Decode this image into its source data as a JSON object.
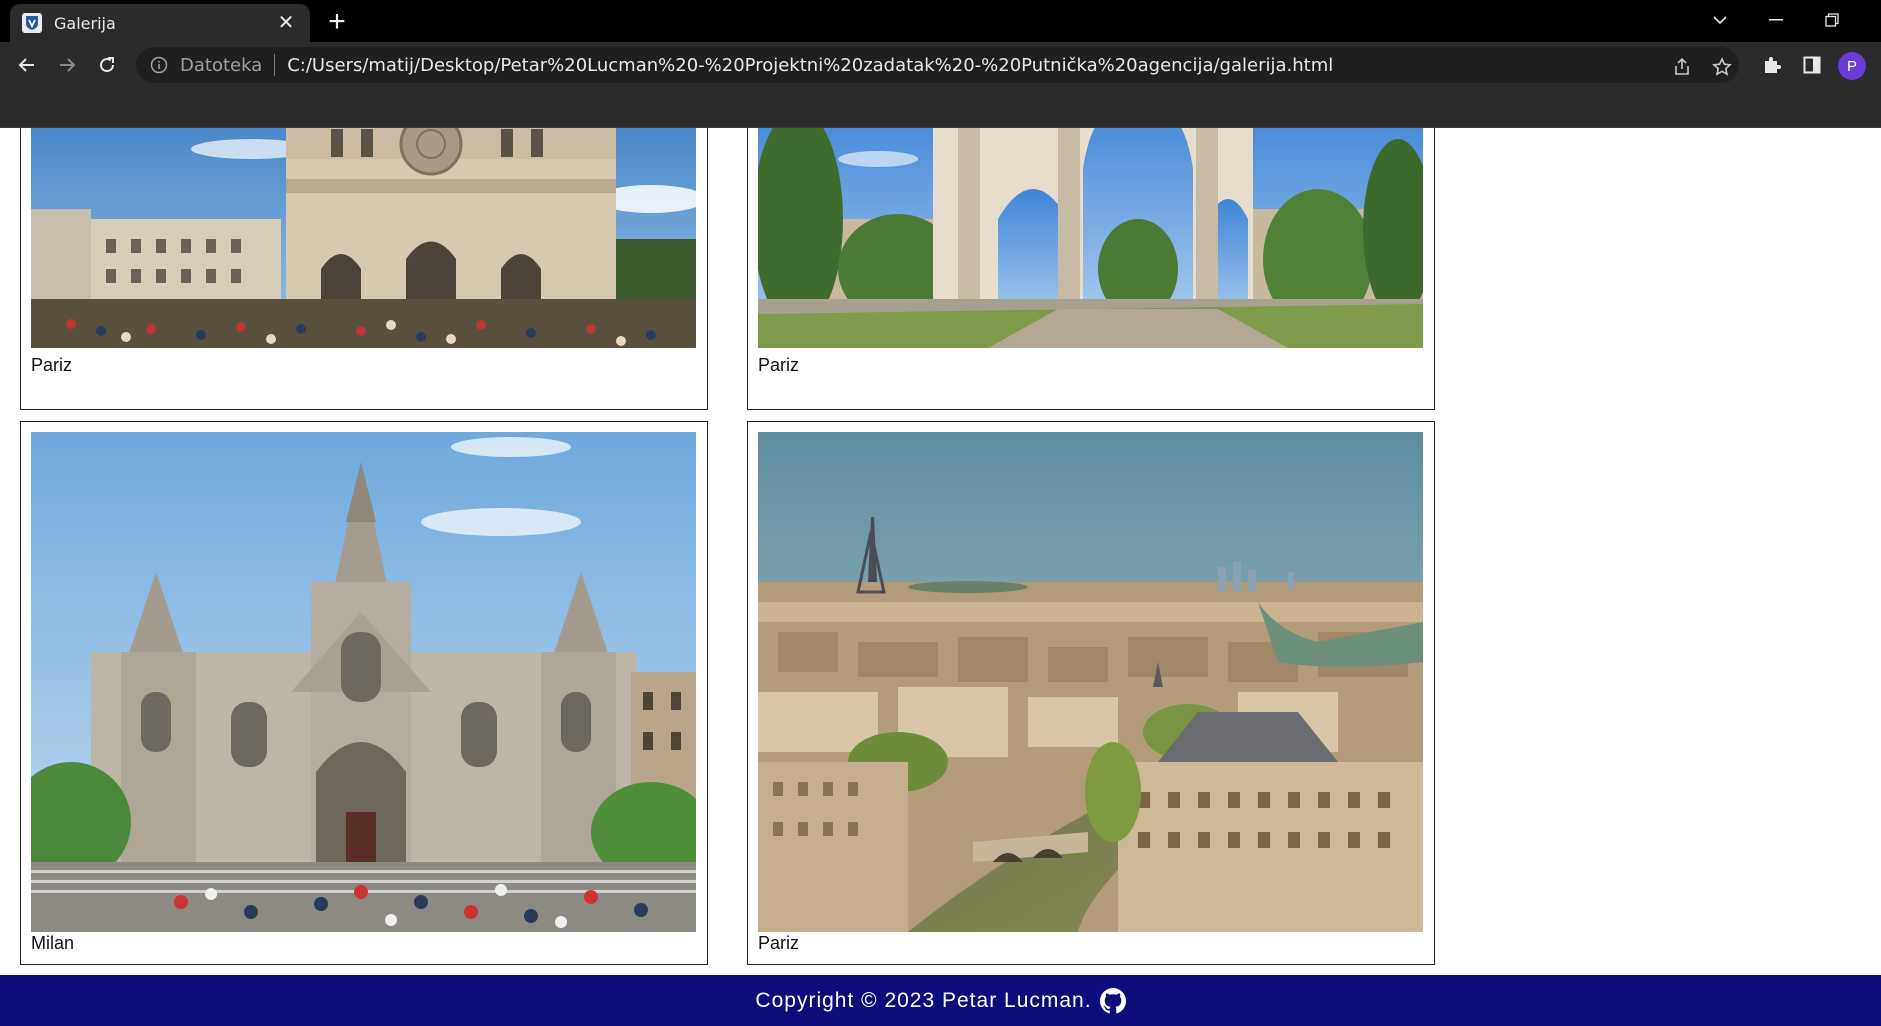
{
  "browser": {
    "tab_title": "Galerija",
    "omnibox_scheme": "Datoteka",
    "url": "C:/Users/matij/Desktop/Petar%20Lucman%20-%20Projektni%20zadatak%20-%20Putnička%20agencija/galerija.html",
    "profile_initial": "P"
  },
  "gallery": {
    "items": [
      {
        "caption": "Pariz",
        "photo": "notre-dame-cathedral"
      },
      {
        "caption": "Pariz",
        "photo": "triumphal-arch"
      },
      {
        "caption": "Milan",
        "photo": "gothic-cathedral-facade"
      },
      {
        "caption": "Pariz",
        "photo": "paris-skyline-eiffel-tower"
      }
    ]
  },
  "footer": {
    "text": "Copyright © 2023 Petar Lucman.",
    "icon": "github-icon"
  },
  "colors": {
    "footer_bg": "#0c0c7a",
    "profile_bg": "#6b3bd6"
  }
}
